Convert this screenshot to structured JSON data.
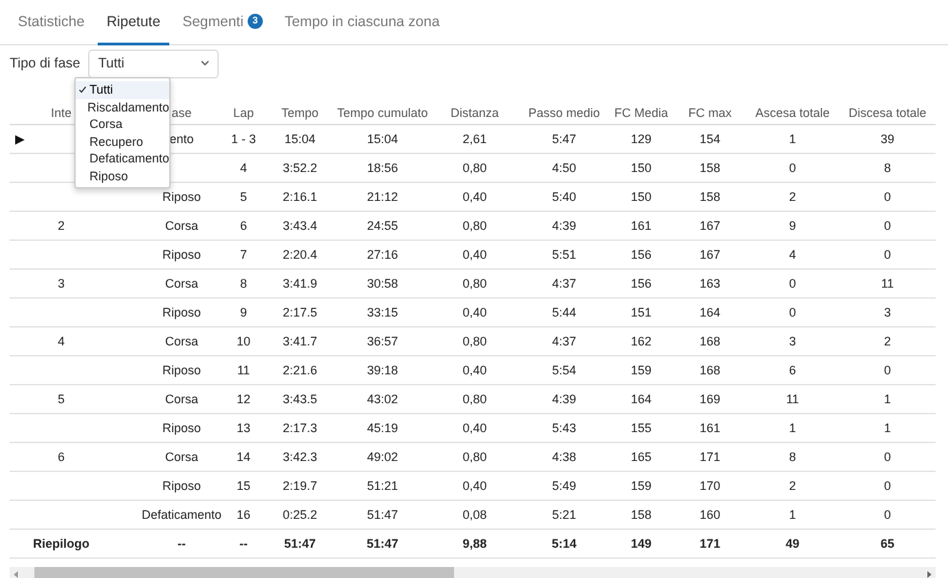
{
  "tabs": [
    {
      "label": "Statistiche",
      "selected": false
    },
    {
      "label": "Ripetute",
      "selected": true
    },
    {
      "label": "Segmenti",
      "selected": false,
      "badge": "3"
    },
    {
      "label": "Tempo in ciascuna zona",
      "selected": false
    }
  ],
  "filter": {
    "label": "Tipo di fase",
    "value": "Tutti",
    "expanded": true,
    "options": [
      {
        "label": "Tutti",
        "selected": true
      },
      {
        "label": "Riscaldamento",
        "selected": false
      },
      {
        "label": "Corsa",
        "selected": false
      },
      {
        "label": "Recupero",
        "selected": false
      },
      {
        "label": "Defaticamento",
        "selected": false
      },
      {
        "label": "Riposo",
        "selected": false
      }
    ]
  },
  "table": {
    "columns": [
      "Inte",
      "ase",
      "Lap",
      "Tempo",
      "Tempo cumulato",
      "Distanza",
      "Passo medio",
      "FC Media",
      "FC max",
      "Ascesa totale",
      "Discesa totale"
    ],
    "rows": [
      {
        "kind": "lap",
        "expander": "▶",
        "cells": [
          "",
          "ento",
          "1 - 3",
          "15:04",
          "15:04",
          "2,61",
          "5:47",
          "129",
          "154",
          "1",
          "39"
        ]
      },
      {
        "kind": "lap",
        "cells": [
          "",
          "",
          "4",
          "3:52.2",
          "18:56",
          "0,80",
          "4:50",
          "150",
          "158",
          "0",
          "8"
        ]
      },
      {
        "kind": "lap",
        "cells": [
          "",
          "Riposo",
          "5",
          "2:16.1",
          "21:12",
          "0,40",
          "5:40",
          "150",
          "158",
          "2",
          "0"
        ]
      },
      {
        "kind": "lap",
        "cells": [
          "2",
          "Corsa",
          "6",
          "3:43.4",
          "24:55",
          "0,80",
          "4:39",
          "161",
          "167",
          "9",
          "0"
        ]
      },
      {
        "kind": "lap",
        "cells": [
          "",
          "Riposo",
          "7",
          "2:20.4",
          "27:16",
          "0,40",
          "5:51",
          "156",
          "167",
          "4",
          "0"
        ]
      },
      {
        "kind": "lap",
        "cells": [
          "3",
          "Corsa",
          "8",
          "3:41.9",
          "30:58",
          "0,80",
          "4:37",
          "156",
          "163",
          "0",
          "11"
        ]
      },
      {
        "kind": "lap",
        "cells": [
          "",
          "Riposo",
          "9",
          "2:17.5",
          "33:15",
          "0,40",
          "5:44",
          "151",
          "164",
          "0",
          "3"
        ]
      },
      {
        "kind": "lap",
        "cells": [
          "4",
          "Corsa",
          "10",
          "3:41.7",
          "36:57",
          "0,80",
          "4:37",
          "162",
          "168",
          "3",
          "2"
        ]
      },
      {
        "kind": "lap",
        "cells": [
          "",
          "Riposo",
          "11",
          "2:21.6",
          "39:18",
          "0,40",
          "5:54",
          "159",
          "168",
          "6",
          "0"
        ]
      },
      {
        "kind": "lap",
        "cells": [
          "5",
          "Corsa",
          "12",
          "3:43.5",
          "43:02",
          "0,80",
          "4:39",
          "164",
          "169",
          "11",
          "1"
        ]
      },
      {
        "kind": "lap",
        "cells": [
          "",
          "Riposo",
          "13",
          "2:17.3",
          "45:19",
          "0,40",
          "5:43",
          "155",
          "161",
          "1",
          "1"
        ]
      },
      {
        "kind": "lap",
        "cells": [
          "6",
          "Corsa",
          "14",
          "3:42.3",
          "49:02",
          "0,80",
          "4:38",
          "165",
          "171",
          "8",
          "0"
        ]
      },
      {
        "kind": "lap",
        "cells": [
          "",
          "Riposo",
          "15",
          "2:19.7",
          "51:21",
          "0,40",
          "5:49",
          "159",
          "170",
          "2",
          "0"
        ]
      },
      {
        "kind": "lap",
        "cells": [
          "",
          "Defaticamento",
          "16",
          "0:25.2",
          "51:47",
          "0,08",
          "5:21",
          "158",
          "160",
          "1",
          "0"
        ]
      },
      {
        "kind": "summary",
        "cells": [
          "Riepilogo",
          "--",
          "--",
          "51:47",
          "51:47",
          "9,88",
          "5:14",
          "149",
          "171",
          "49",
          "65"
        ]
      }
    ]
  }
}
